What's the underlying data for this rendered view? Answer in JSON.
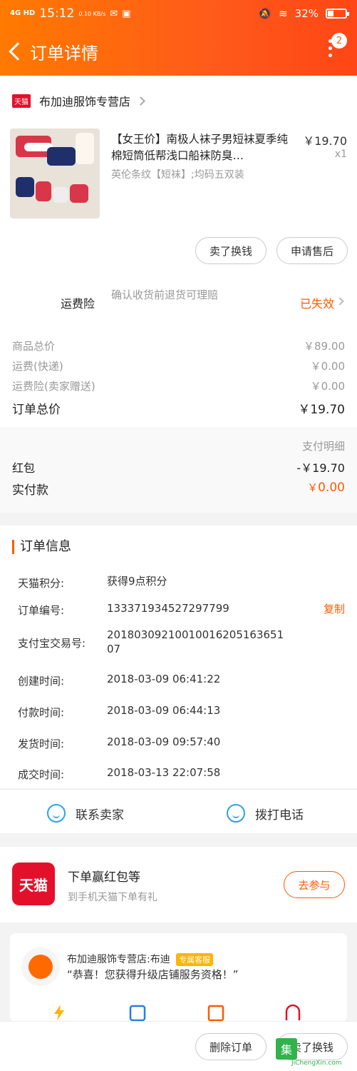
{
  "status_bar": {
    "signal": "4G\nHD",
    "time": "15:12",
    "net_speed": "0.10\nKB/s",
    "battery": "32%"
  },
  "nav": {
    "title": "订单详情",
    "badge": "2"
  },
  "shop": {
    "tag": "天猫",
    "name": "布加迪服饰专营店"
  },
  "product": {
    "title": "【女王价】南极人袜子男短袜夏季纯棉短筒低帮浅口船袜防臭…",
    "spec": "英伦条纹【短袜】;均码五双装",
    "price": "￥19.70",
    "qty": "x1"
  },
  "actions": {
    "sell": "卖了换钱",
    "after_sale": "申请售后"
  },
  "insurance": {
    "label": "运费险",
    "desc": "确认收货前退货可理赔",
    "status": "已失效"
  },
  "summary": {
    "goods_label": "商品总价",
    "goods_value": "￥89.00",
    "shipping_label": "运费(快递)",
    "shipping_value": "￥0.00",
    "ins_label": "运费险(卖家赠送)",
    "ins_value": "￥0.00",
    "total_label": "订单总价",
    "total_value": "￥19.70"
  },
  "payment": {
    "detail_link": "支付明细",
    "redpack_label": "红包",
    "redpack_value": "-￥19.70",
    "paid_label": "实付款",
    "paid_currency": "￥",
    "paid_value": "0.00"
  },
  "order_info": {
    "title": "订单信息",
    "copy": "复制",
    "rows": [
      {
        "label": "天猫积分:",
        "value": "获得9点积分"
      },
      {
        "label": "订单编号:",
        "value": "133371934527297799"
      },
      {
        "label": "支付宝交易号:",
        "value": "20180309210010016205163651 07"
      },
      {
        "label": "创建时间:",
        "value": "2018-03-09 06:41:22"
      },
      {
        "label": "付款时间:",
        "value": "2018-03-09 06:44:13"
      },
      {
        "label": "发货时间:",
        "value": "2018-03-09 09:57:40"
      },
      {
        "label": "成交时间:",
        "value": "2018-03-13 22:07:58"
      }
    ]
  },
  "contact": {
    "seller": "联系卖家",
    "phone": "拨打电话"
  },
  "promo": {
    "logo": "天猫",
    "title": "下单赢红包等",
    "subtitle": "到手机天猫下单有礼",
    "button": "去参与"
  },
  "service": {
    "name": "布加迪服饰专营店:布迪",
    "tag": "专属客服",
    "message": "“恭喜！您获得升级店铺服务资格！”"
  },
  "bottom": {
    "delete": "删除订单",
    "sell": "卖了换钱"
  },
  "watermark": {
    "logo": "集",
    "text": "JiChengXin.com"
  },
  "colors": {
    "brand": "#ff5a1a",
    "accent": "#ff5a00",
    "tmall_red": "#e4102b",
    "link_blue": "#2aa5e5"
  }
}
